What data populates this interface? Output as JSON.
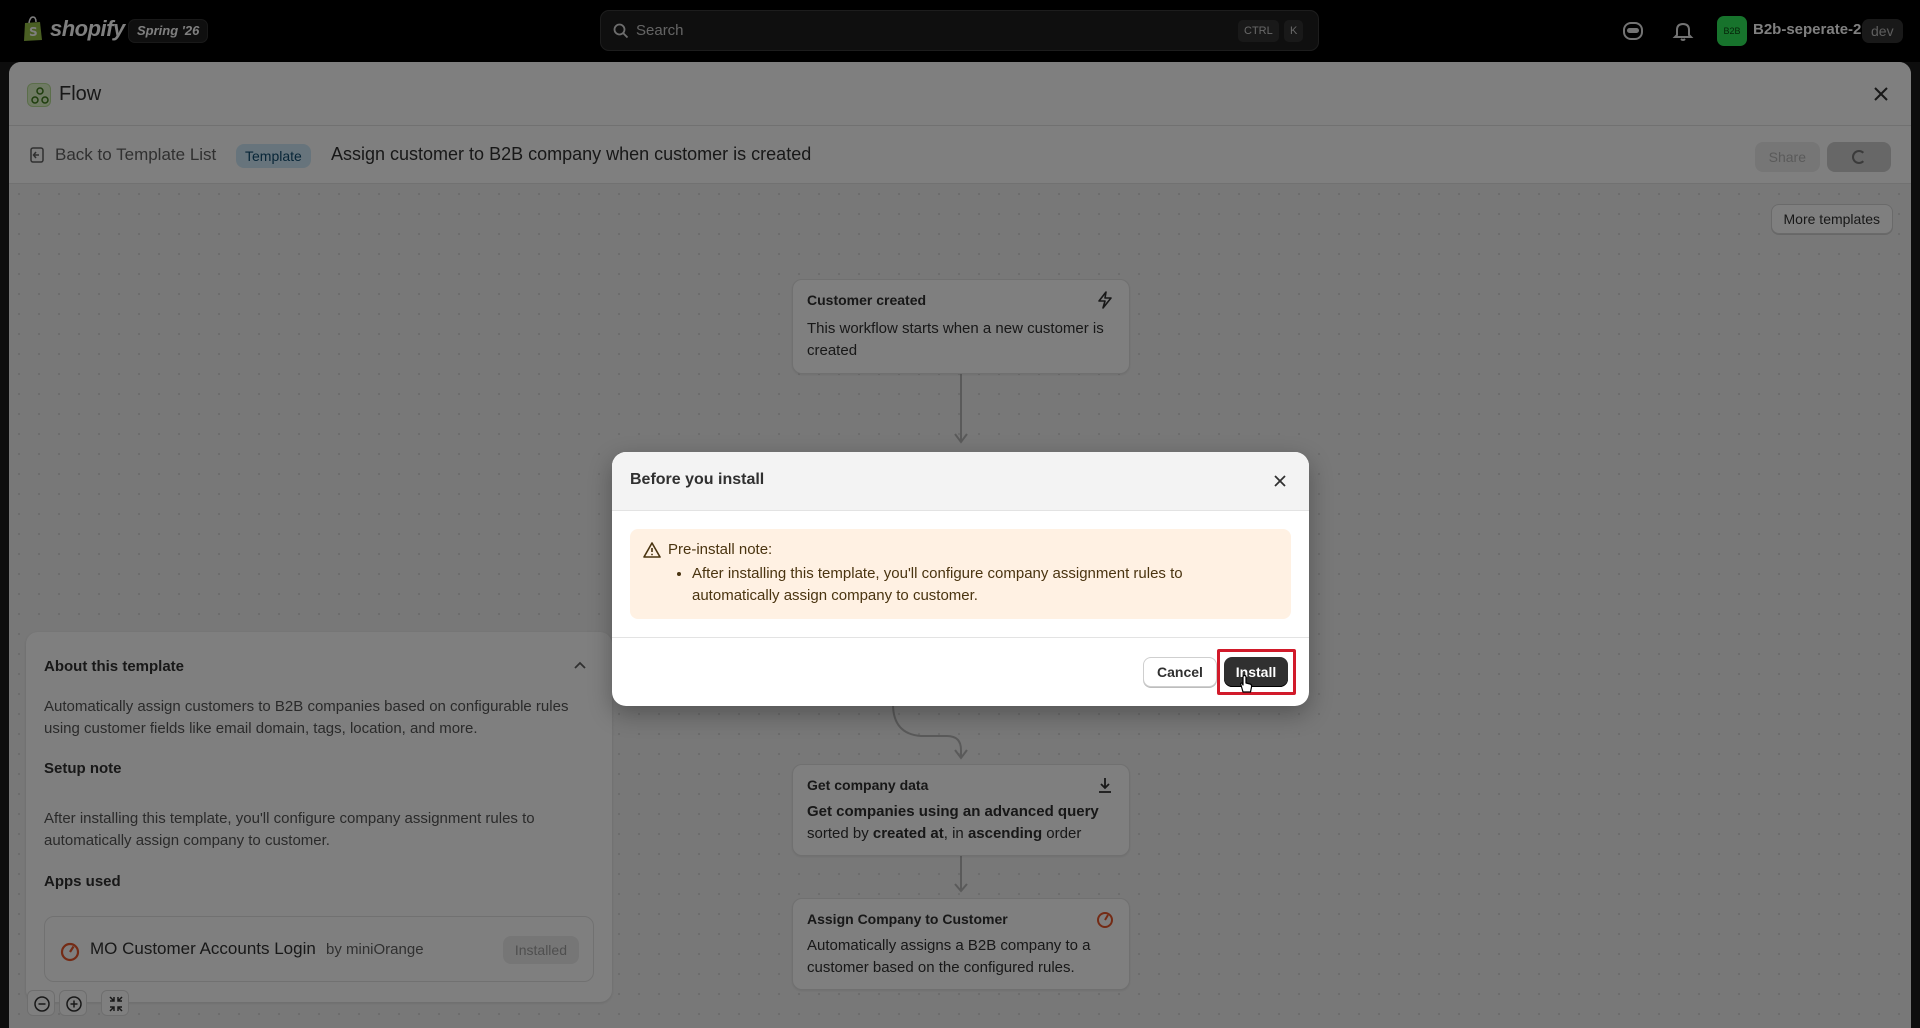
{
  "topbar": {
    "brand": "shopify",
    "edition": "Spring '26",
    "search_placeholder": "Search",
    "shortcut_ctrl": "CTRL",
    "shortcut_key": "K",
    "store_avatar": "B2B",
    "store_name": "B2b-seperate-2",
    "env_badge": "dev"
  },
  "app": {
    "title": "Flow",
    "back_label": "Back to Template List",
    "badge": "Template",
    "template_title": "Assign customer to B2B company when customer is created",
    "share_label": "Share",
    "more_templates_label": "More templates"
  },
  "nodes": {
    "trigger": {
      "title": "Customer created",
      "desc": "This workflow starts when a new customer is created",
      "icon": "lightning-icon"
    },
    "get_data": {
      "title": "Get company data",
      "desc_pre": "Get companies using an advanced query",
      "desc_mid1": "sorted by ",
      "desc_b1": "created at",
      "desc_mid2": ", in ",
      "desc_b2": "ascending",
      "desc_end": " order",
      "icon": "download-icon"
    },
    "assign": {
      "title": "Assign Company to Customer",
      "desc": "Automatically assigns a B2B company to a customer based on the configured rules.",
      "icon": "app-icon"
    }
  },
  "about": {
    "title": "About this template",
    "desc": "Automatically assign customers to B2B companies based on configurable rules using customer fields like email domain, tags, location, and more.",
    "setup_title": "Setup note",
    "setup_desc": "After installing this template, you'll configure company assignment rules to automatically assign company to customer.",
    "apps_title": "Apps used",
    "app_name": "MO Customer Accounts Login",
    "app_by": "by miniOrange",
    "app_status": "Installed"
  },
  "modal": {
    "title": "Before you install",
    "note_heading": "Pre-install note:",
    "note_item": "After installing this template, you'll configure company assignment rules to automatically assign company to customer.",
    "cancel_label": "Cancel",
    "install_label": "Install"
  },
  "colors": {
    "accent_highlight": "#d11a2a",
    "primary_button": "#303030",
    "note_bg": "#fff1e3",
    "store_avatar": "#2ee659"
  }
}
